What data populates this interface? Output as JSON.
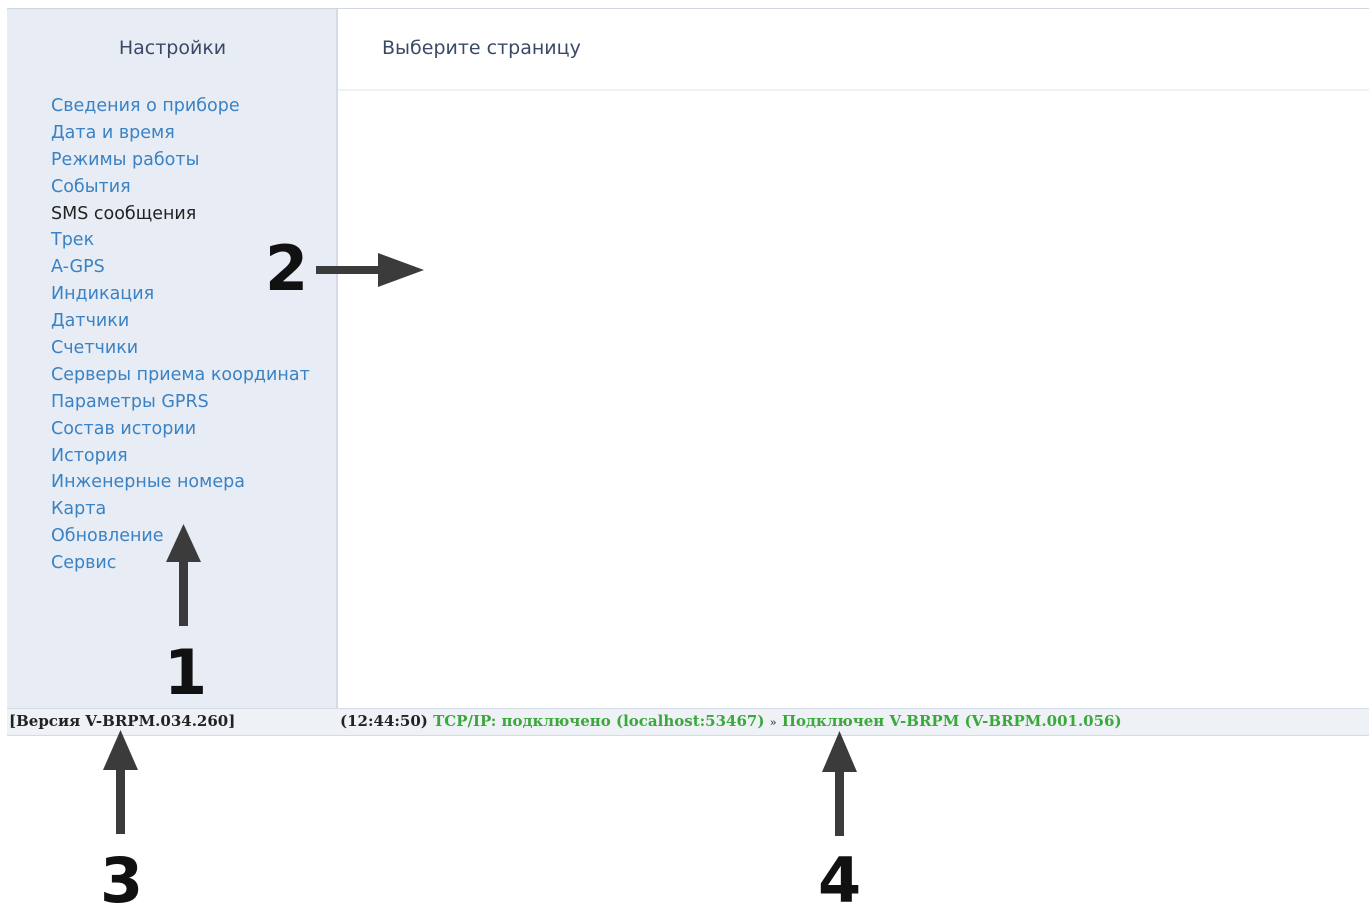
{
  "sidebar": {
    "title": "Настройки",
    "items": [
      {
        "label": "Сведения о приборе"
      },
      {
        "label": "Дата и время"
      },
      {
        "label": "Режимы работы"
      },
      {
        "label": "События"
      },
      {
        "label": "SMS сообщения",
        "active": true
      },
      {
        "label": "Трек"
      },
      {
        "label": "A-GPS"
      },
      {
        "label": "Индикация"
      },
      {
        "label": "Датчики"
      },
      {
        "label": "Счетчики"
      },
      {
        "label": "Серверы приема координат"
      },
      {
        "label": "Параметры GPRS"
      },
      {
        "label": "Состав истории"
      },
      {
        "label": "История"
      },
      {
        "label": "Инженерные номера"
      },
      {
        "label": "Карта"
      },
      {
        "label": "Обновление"
      },
      {
        "label": "Сервис"
      }
    ]
  },
  "main": {
    "title": "Выберите страницу"
  },
  "statusbar": {
    "version": "[Версия V-BRPM.034.260]",
    "time": "(12:44:50)",
    "tcp": "TCP/IP: подключено (localhost:53467)",
    "separator": "»",
    "device": "Подключен V-BRPM (V-BRPM.001.056)"
  },
  "annotations": {
    "one": "1",
    "two": "2",
    "three": "3",
    "four": "4"
  },
  "colors": {
    "link": "#3a82c4",
    "active": "#222222",
    "status_ok": "#3aa83a",
    "sidebar_bg": "#e8edf5"
  }
}
